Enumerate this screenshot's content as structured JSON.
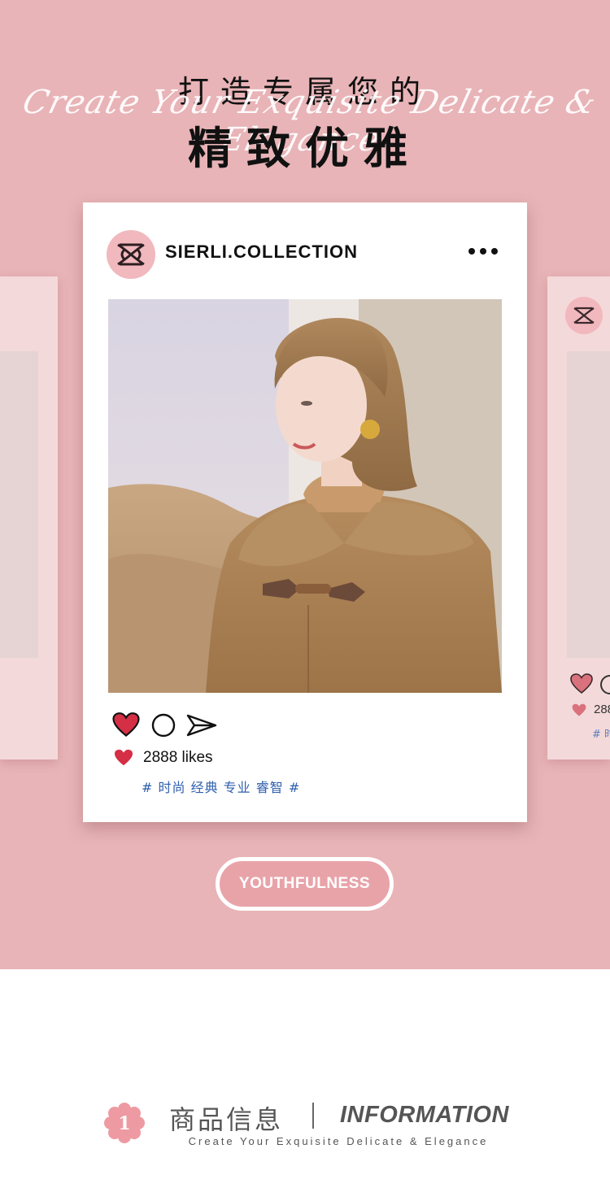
{
  "header": {
    "title_line1": "打造专属您的",
    "script_text": "Create Your Exquisite Delicate & Elegance",
    "title_line2": "精致优雅"
  },
  "post": {
    "handle": "SIERLI.COLLECTION",
    "avatar_icon": "sierli-logo-icon",
    "more_icon": "more-dots-icon",
    "likes_text": "2888 likes",
    "hashtags": "# 时尚 经典 专业 睿智 #"
  },
  "side_post": {
    "likes_text": "288",
    "hashtags": "# 时"
  },
  "badge": {
    "label": "YOUTHFULNESS"
  },
  "section": {
    "number": "1",
    "title_cn": "商品信息",
    "title_en": "INFORMATION",
    "subtitle": "Create Your Exquisite Delicate & Elegance"
  },
  "colors": {
    "background_pink": "#e8b4b7",
    "card_side_pink": "#f4d9da",
    "heart_red": "#d42f45",
    "hashtag_blue": "#2f5fad"
  }
}
